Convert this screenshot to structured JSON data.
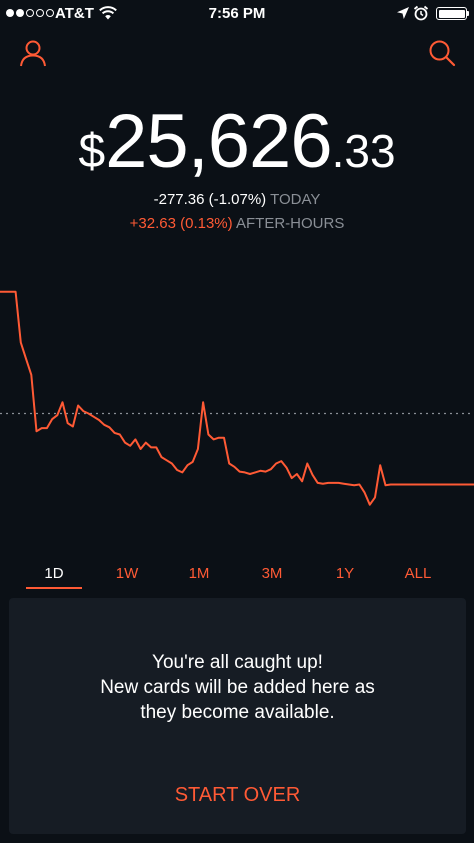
{
  "status_bar": {
    "carrier": "AT&T",
    "time": "7:56 PM",
    "signal_bars_filled": 2,
    "signal_bars_total": 5,
    "battery_level": 1.0
  },
  "header": {
    "profile_icon": "person-icon",
    "search_icon": "search-icon"
  },
  "portfolio": {
    "currency": "$",
    "value_whole": "25,626",
    "value_cents": ".33"
  },
  "change": {
    "today_value": "-277.36 (-1.07%)",
    "today_label": "TODAY",
    "after_value": "+32.63 (0.13%)",
    "after_label": "AFTER-HOURS"
  },
  "chart_data": {
    "type": "line",
    "series": [
      {
        "values": [
          25903,
          25903,
          25903,
          25903,
          25840,
          25820,
          25800,
          25730,
          25734,
          25734,
          25745,
          25750,
          25766,
          25740,
          25736,
          25762,
          25755,
          25752,
          25748,
          25744,
          25738,
          25735,
          25728,
          25726,
          25716,
          25712,
          25720,
          25708,
          25716,
          25710,
          25710,
          25698,
          25694,
          25690,
          25682,
          25679,
          25688,
          25692,
          25708,
          25766,
          25726,
          25720,
          25722,
          25722,
          25690,
          25686,
          25680,
          25679,
          25677,
          25679,
          25681,
          25680,
          25683,
          25690,
          25693,
          25685,
          25672,
          25677,
          25668,
          25690,
          25676,
          25666,
          25665,
          25666,
          25666,
          25666,
          25665,
          25664,
          25663,
          25664,
          25654,
          25639,
          25648,
          25688,
          25663,
          25664,
          25664,
          25664,
          25664,
          25664,
          25664,
          25664,
          25664,
          25664,
          25664,
          25664,
          25664,
          25664,
          25664,
          25664,
          25664,
          25664
        ]
      }
    ],
    "previous_close": 25752,
    "y_range": [
      25620,
      25930
    ],
    "line_color": "#ff5a35",
    "reference_line_color": "#8a8f96"
  },
  "range_tabs": [
    "1D",
    "1W",
    "1M",
    "3M",
    "1Y",
    "ALL"
  ],
  "active_range": "1D",
  "card": {
    "line1": "You're all caught up!",
    "line2": "New cards will be added here as",
    "line3": "they become available.",
    "action_label": "START OVER"
  },
  "colors": {
    "background": "#0b1016",
    "card_background": "#161c24",
    "accent": "#ff5a35",
    "muted_text": "#8a8f96"
  }
}
